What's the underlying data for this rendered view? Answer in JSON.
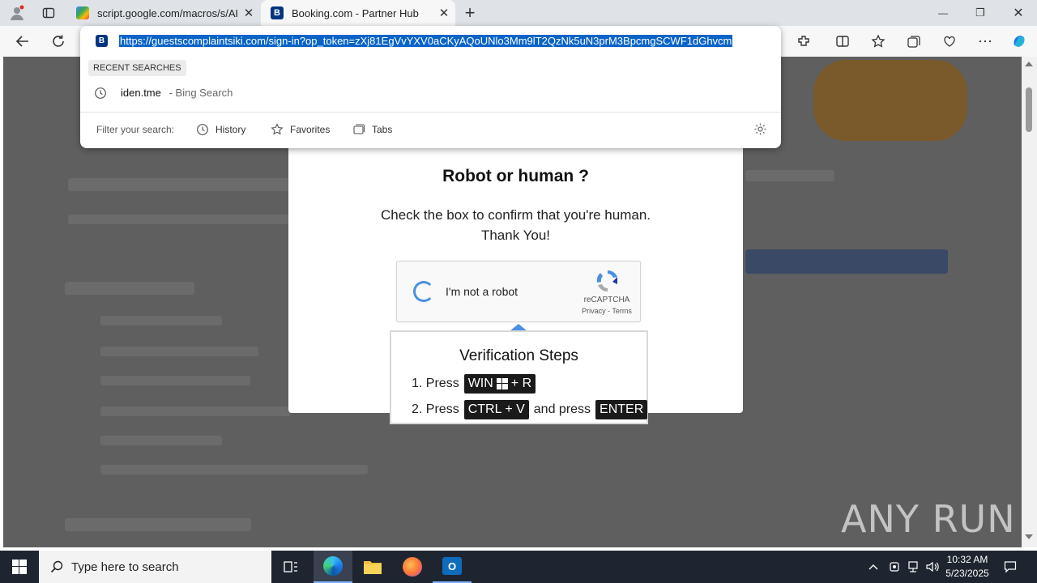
{
  "browser": {
    "tabs": [
      {
        "title": "script.google.com/macros/s/AKf",
        "close": "✕"
      },
      {
        "title": "Booking.com - Partner Hub",
        "close": "✕"
      }
    ],
    "new_tab": "+",
    "window_controls": {
      "minimize": "—",
      "restore": "❐",
      "close": "✕"
    },
    "address_url": "https://guestscomplaintsiki.com/sign-in?op_token=zXj81EgVvYXV0aCKyAQoUNlo3Mm9lT2QzNk5uN3prM3BpcmgSCWF1dGhvcm",
    "favicon_letter": "B",
    "dropdown": {
      "recent_label": "RECENT SEARCHES",
      "recent_item": "iden.tme",
      "recent_suffix": " - Bing Search",
      "filter_label": "Filter your search:",
      "filters": [
        "History",
        "Favorites",
        "Tabs"
      ]
    }
  },
  "modal": {
    "title": "Robot or human ?",
    "line1": "Check the box to confirm that you're human.",
    "line2": "Thank You!",
    "captcha": {
      "label": "I'm not a robot",
      "brand": "reCAPTCHA",
      "links": "Privacy - Terms"
    },
    "steps": {
      "title": "Verification Steps",
      "s1_prefix": "1. Press",
      "s1_key": "WIN",
      "s1_suffix": "+ R",
      "s2_prefix": "2. Press",
      "s2_key": "CTRL + V",
      "s2_mid": "and press",
      "s2_key2": "ENTER"
    }
  },
  "watermark": "ANY RUN",
  "taskbar": {
    "search_placeholder": "Type here to search",
    "time": "10:32 AM",
    "date": "5/23/2025"
  },
  "colors": {
    "accent": "#0066cc",
    "booking": "#003580",
    "highlight": "#0a64c8"
  }
}
